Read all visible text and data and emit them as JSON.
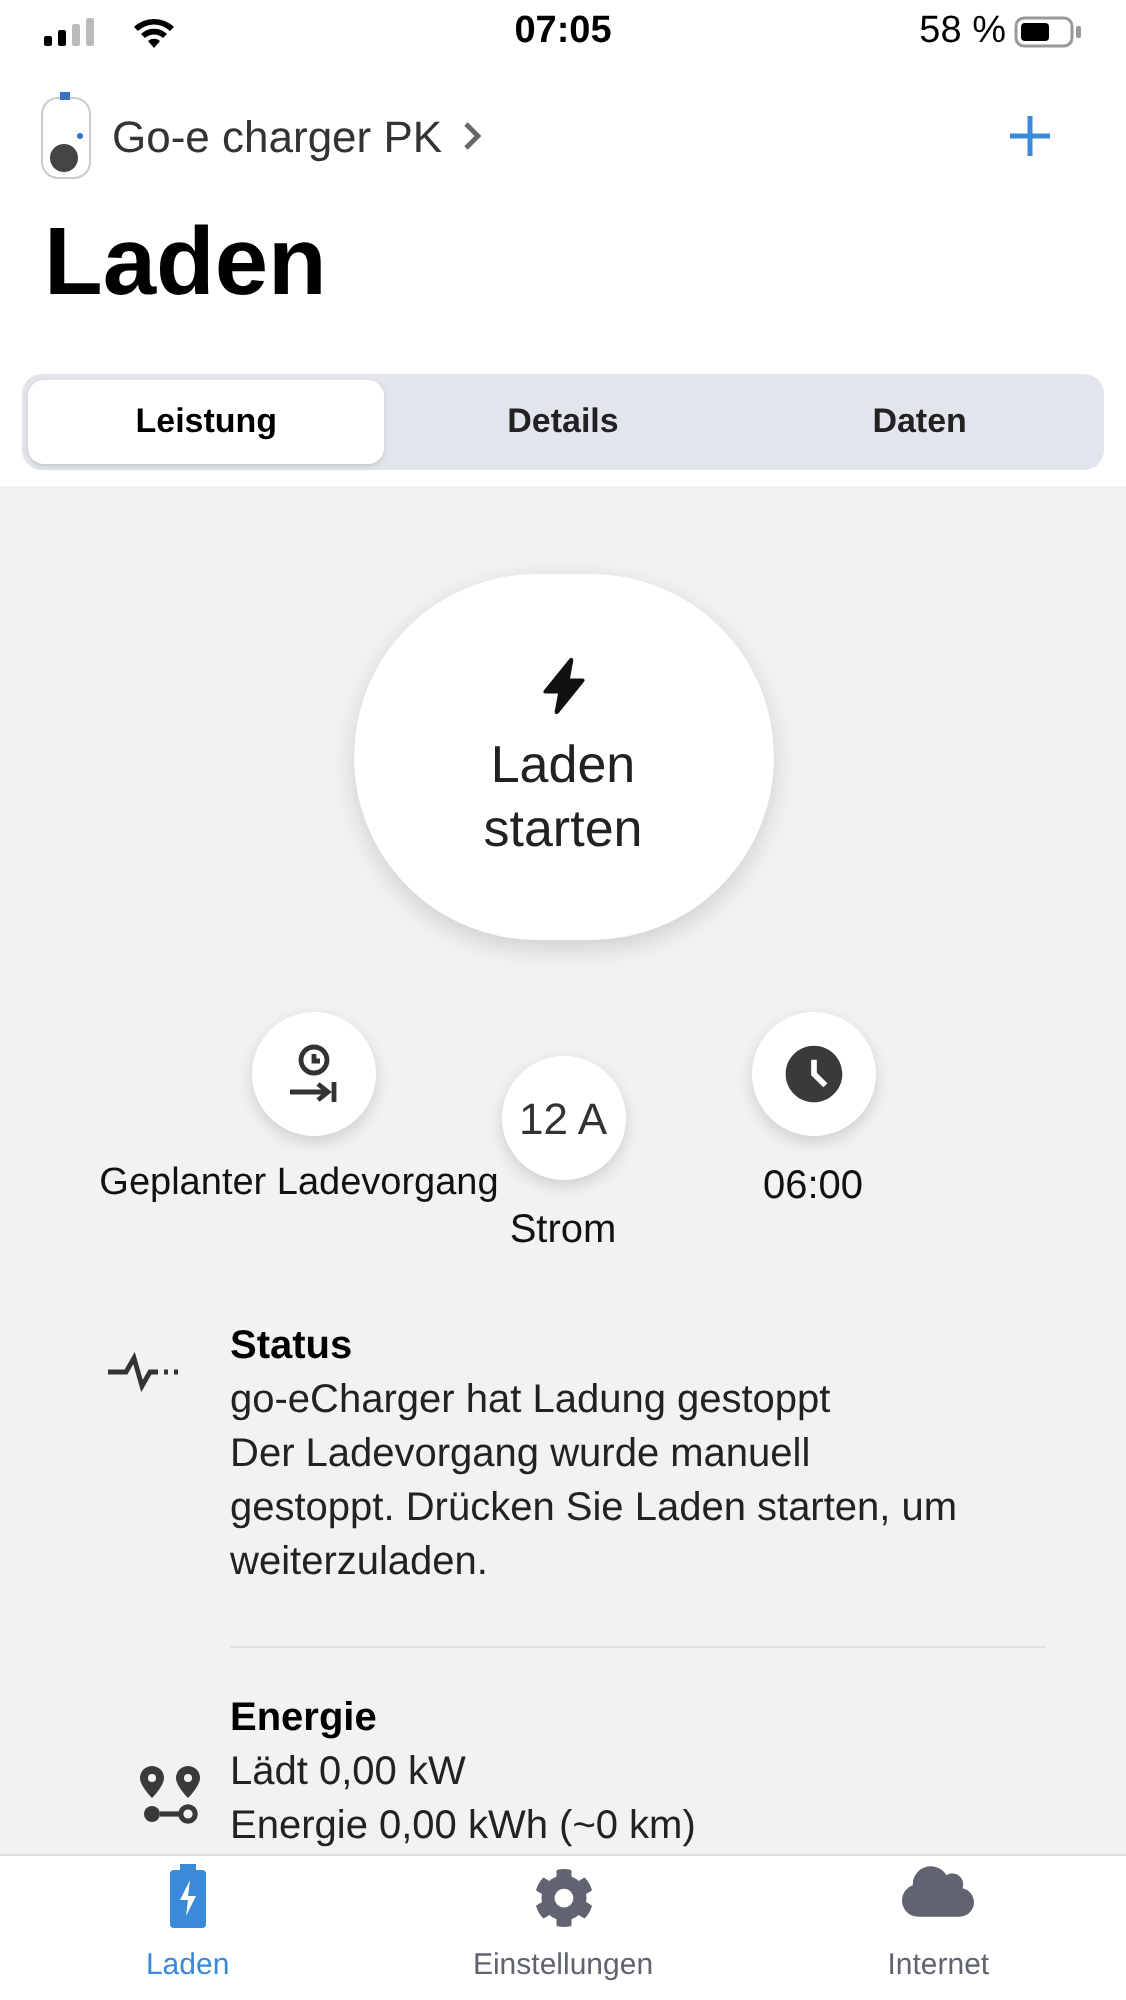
{
  "status_bar": {
    "time": "07:05",
    "battery": "58 %"
  },
  "header": {
    "device": "Go-e charger PK",
    "title": "Laden"
  },
  "tabs": [
    {
      "label": "Leistung",
      "selected": true
    },
    {
      "label": "Details",
      "selected": false
    },
    {
      "label": "Daten",
      "selected": false
    }
  ],
  "charge_button": {
    "label": "Laden starten"
  },
  "quick_actions": [
    {
      "kind": "schedule",
      "caption": "Geplanter Ladevorgang"
    },
    {
      "kind": "current",
      "button_text": "12 A",
      "caption": "Strom"
    },
    {
      "kind": "time",
      "caption": "06:00"
    }
  ],
  "info": [
    {
      "kind": "status",
      "title": "Status",
      "lines": [
        "go-eCharger hat Ladung gestoppt",
        "Der Ladevorgang wurde manuell gestoppt. Drücken Sie Laden starten, um weiterzuladen."
      ]
    },
    {
      "kind": "energy",
      "title": "Energie",
      "lines": [
        "Lädt 0,00 kW",
        "Energie 0,00 kWh (~0 km)"
      ]
    }
  ],
  "nav": [
    {
      "kind": "charge",
      "label": "Laden",
      "selected": true
    },
    {
      "kind": "settings",
      "label": "Einstellungen",
      "selected": false
    },
    {
      "kind": "internet",
      "label": "Internet",
      "selected": false
    }
  ]
}
